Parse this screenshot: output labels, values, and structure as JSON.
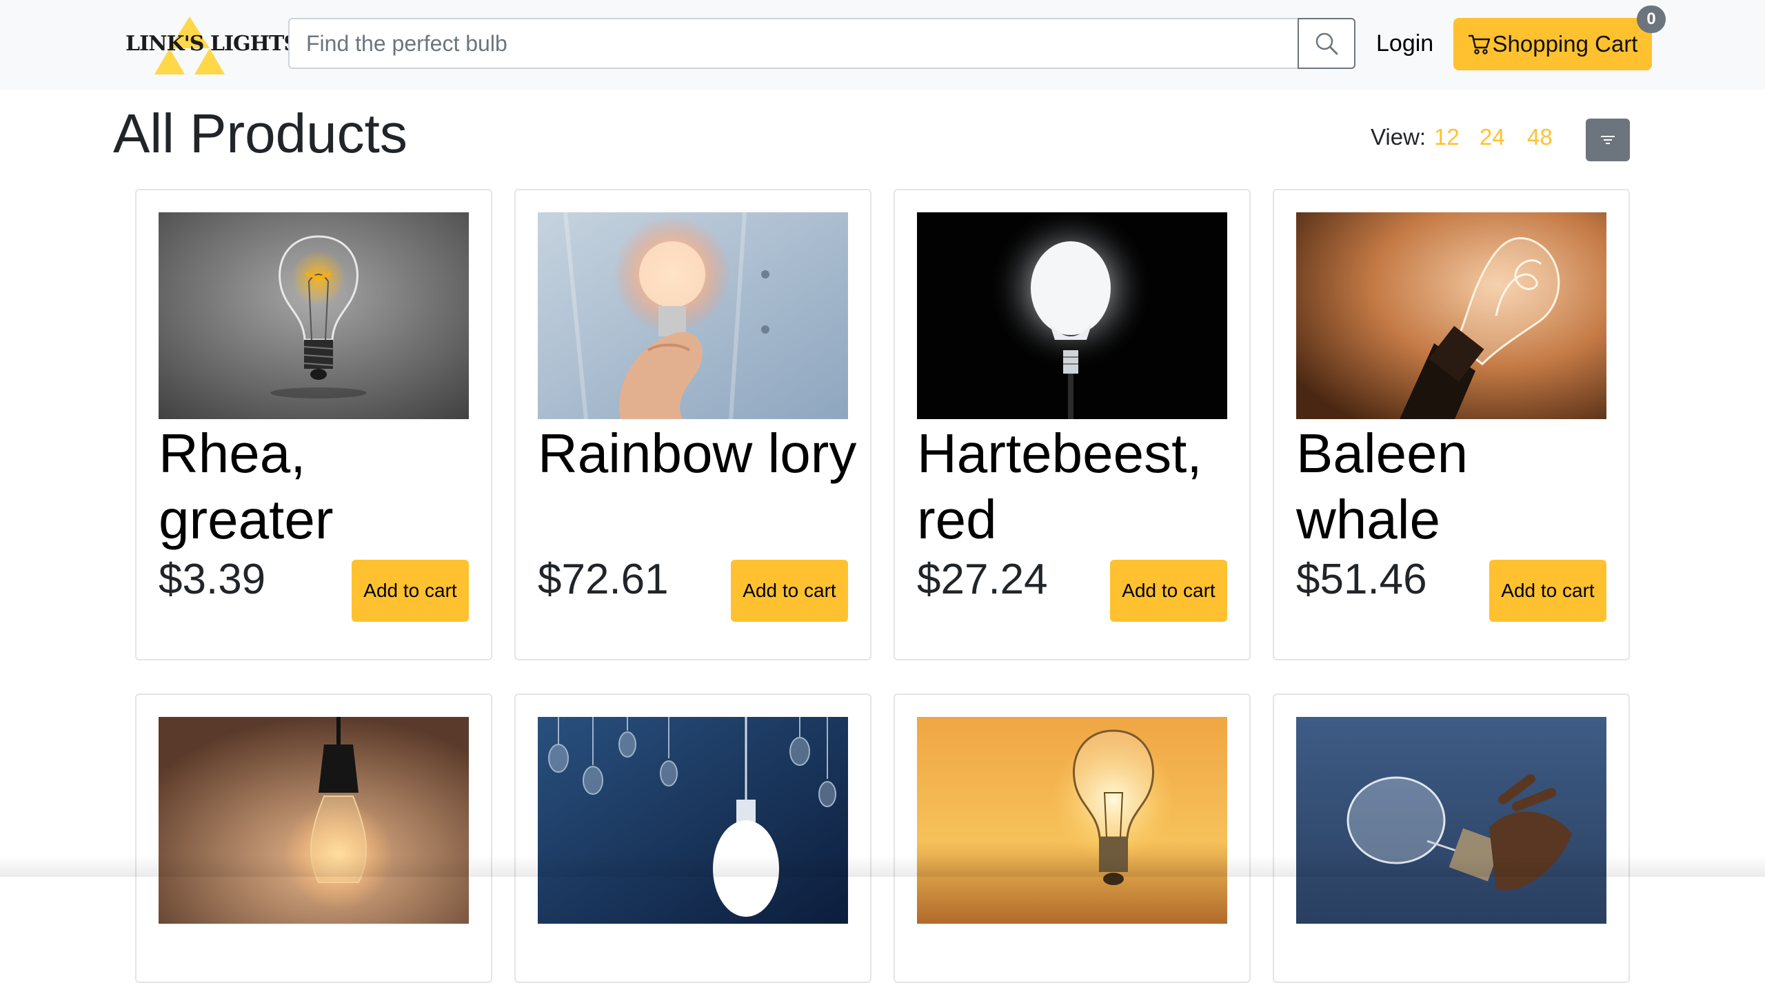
{
  "header": {
    "logo_text": "LINK'S LIGHTS",
    "search_placeholder": "Find the perfect bulb",
    "login_label": "Login",
    "cart_label": "Shopping Cart",
    "cart_count": "0"
  },
  "main": {
    "title": "All Products",
    "view_label": "View:",
    "view_options": [
      "12",
      "24",
      "48"
    ],
    "products": [
      {
        "name": "Rhea, greater",
        "price": "$3.39",
        "button": "Add to cart"
      },
      {
        "name": "Rainbow lory",
        "price": "$72.61",
        "button": "Add to cart"
      },
      {
        "name": "Hartebeest, red",
        "price": "$27.24",
        "button": "Add to cart"
      },
      {
        "name": "Baleen whale",
        "price": "$51.46",
        "button": "Add to cart"
      }
    ]
  },
  "colors": {
    "accent": "#ffc12f",
    "header_bg": "#f8f9fa",
    "secondary": "#6c757d"
  },
  "icons": {
    "search": "search-icon",
    "cart": "cart-icon",
    "filter": "filter-icon"
  }
}
